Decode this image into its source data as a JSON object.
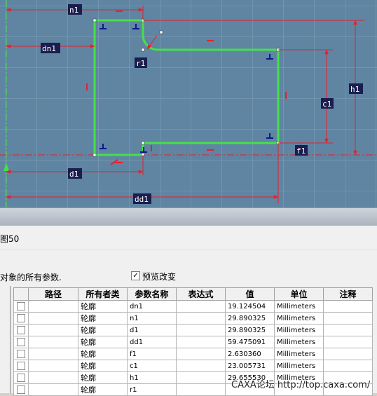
{
  "colors": {
    "canvas_bg": "#5f85a2",
    "grid": "#7b9bb4",
    "profile": "#46e04a",
    "dimension": "#e8202a",
    "label_bg": "#1b1d4e",
    "label_text": "#ffffff"
  },
  "sketch": {
    "dimension_labels": {
      "n1": "n1",
      "dn1": "dn1",
      "r1": "r1",
      "h1": "h1",
      "c1": "c1",
      "f1": "f1",
      "d1": "d1",
      "dd1": "dd1"
    }
  },
  "panel": {
    "title": "图50",
    "description": "对象的所有参数.",
    "preview_checkbox": {
      "label": "预览改变",
      "checked": true
    }
  },
  "table": {
    "columns": [
      "",
      "路径",
      "所有者类",
      "参数名称",
      "表达式",
      "值",
      "单位",
      "注释"
    ],
    "rows": [
      {
        "path": "",
        "owner": "轮廓",
        "name": "dn1",
        "expr": "",
        "value": "19.124504",
        "unit": "Millimeters",
        "note": ""
      },
      {
        "path": "",
        "owner": "轮廓",
        "name": "n1",
        "expr": "",
        "value": "29.890325",
        "unit": "Millimeters",
        "note": ""
      },
      {
        "path": "",
        "owner": "轮廓",
        "name": "d1",
        "expr": "",
        "value": "29.890325",
        "unit": "Millimeters",
        "note": ""
      },
      {
        "path": "",
        "owner": "轮廓",
        "name": "dd1",
        "expr": "",
        "value": "59.475091",
        "unit": "Millimeters",
        "note": ""
      },
      {
        "path": "",
        "owner": "轮廓",
        "name": "f1",
        "expr": "",
        "value": "2.630360",
        "unit": "Millimeters",
        "note": ""
      },
      {
        "path": "",
        "owner": "轮廓",
        "name": "c1",
        "expr": "",
        "value": "23.005731",
        "unit": "Millimeters",
        "note": ""
      },
      {
        "path": "",
        "owner": "轮廓",
        "name": "h1",
        "expr": "",
        "value": "29.655530",
        "unit": "Millimeters",
        "note": ""
      },
      {
        "path": "",
        "owner": "轮廓",
        "name": "r1",
        "expr": "",
        "value": "",
        "unit": "",
        "note": ""
      }
    ]
  },
  "watermark": "CAXA论坛 http://top.caxa.com/"
}
